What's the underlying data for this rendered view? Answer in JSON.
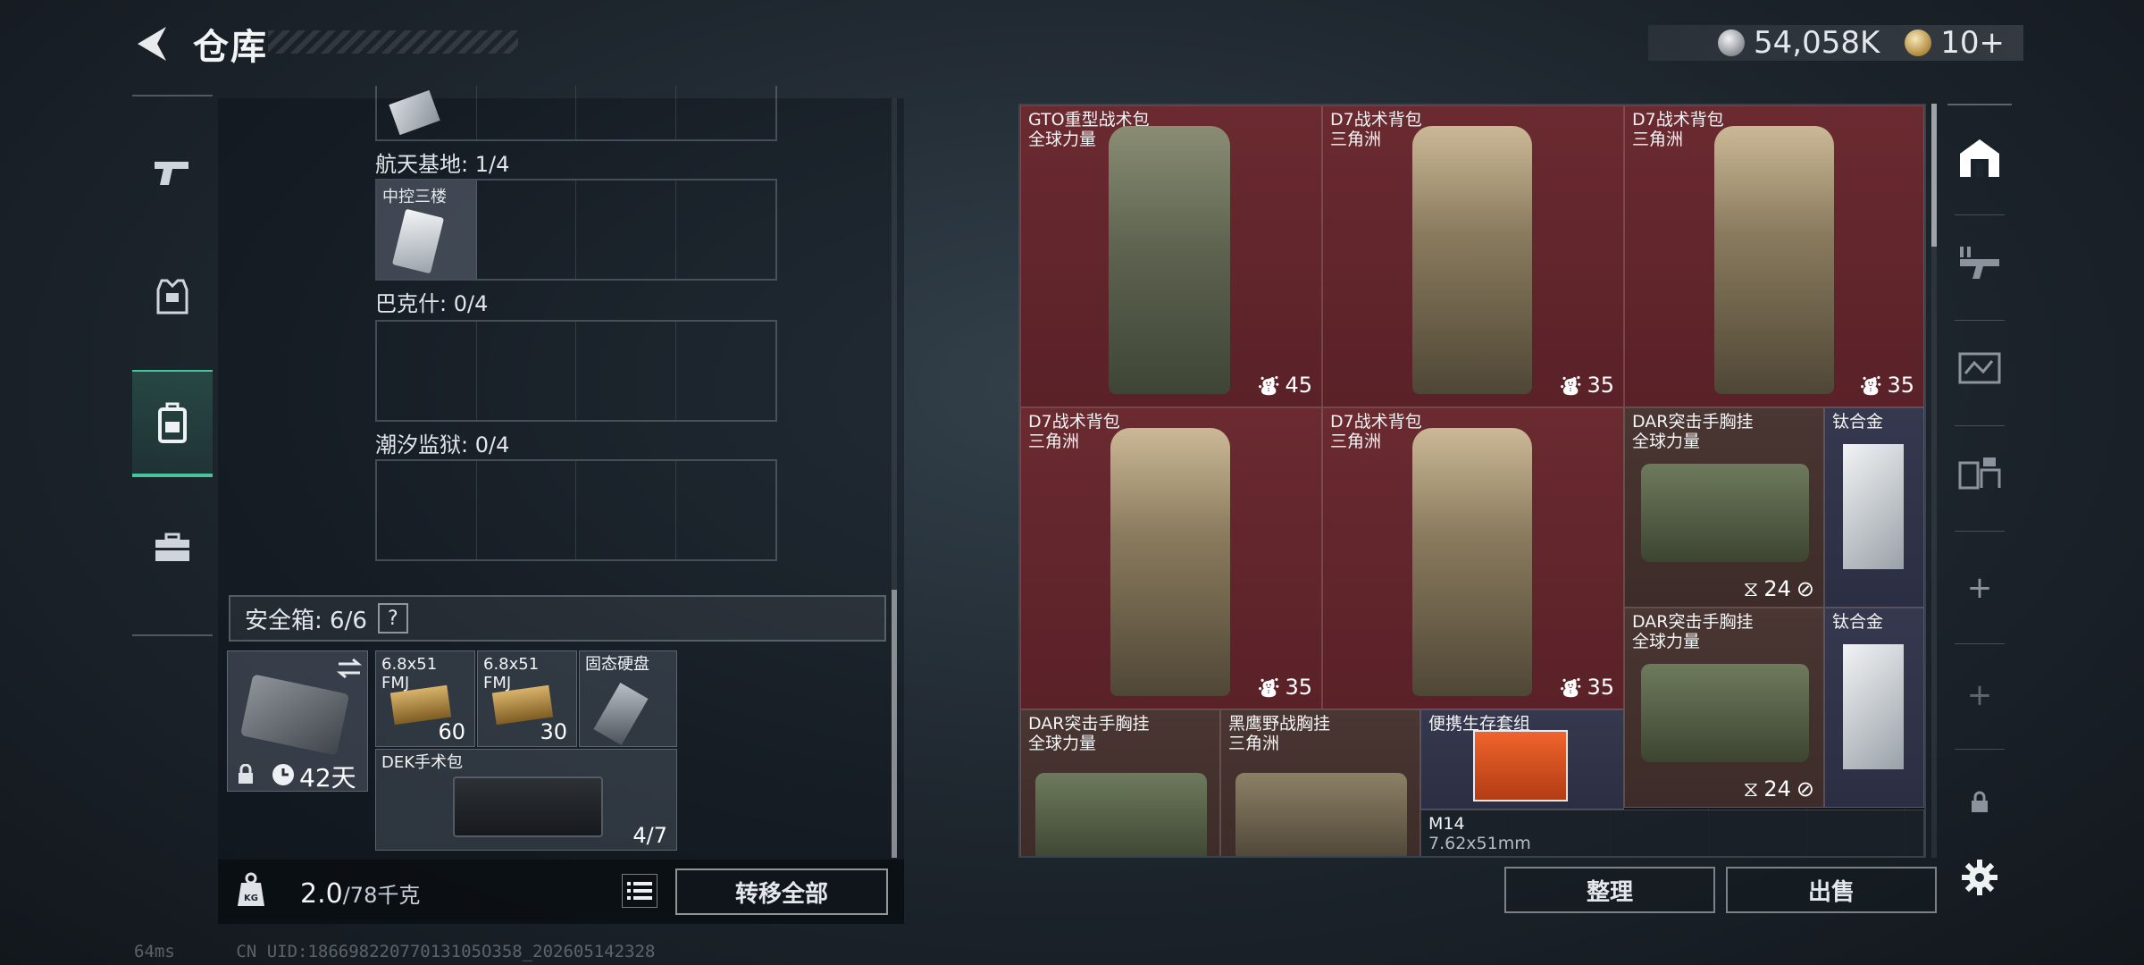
{
  "header": {
    "title": "仓库",
    "currency": {
      "silver": "54,058K",
      "gold": "10+"
    }
  },
  "left_nav": {
    "items": [
      {
        "icon": "pistol-icon"
      },
      {
        "icon": "armor-vest-icon"
      },
      {
        "icon": "backpack-icon",
        "active": true
      },
      {
        "icon": "briefcase-icon"
      }
    ]
  },
  "storage": {
    "sections": [
      {
        "label": "航天基地: 1/4",
        "items": [
          {
            "name": "中控三楼"
          }
        ]
      },
      {
        "label": "巴克什: 0/4",
        "items": []
      },
      {
        "label": "潮汐监狱: 0/4",
        "items": []
      }
    ]
  },
  "safebox": {
    "label": "安全箱: 6/6",
    "help": "?",
    "duration": "42天",
    "items": [
      {
        "name": "6.8x51\nFMJ",
        "count": "60"
      },
      {
        "name": "6.8x51\nFMJ",
        "count": "30"
      },
      {
        "name": "固态硬盘",
        "count": ""
      },
      {
        "name": "DEK手术包",
        "count": "4/7"
      }
    ]
  },
  "weight": {
    "current": "2.0",
    "max": "/78千克"
  },
  "transfer_all": "转移全部",
  "inventory": {
    "items": [
      {
        "name": "GTO重型战术包",
        "sub": "全球力量",
        "cap": "45",
        "color": "red"
      },
      {
        "name": "D7战术背包",
        "sub": "三角洲",
        "cap": "35",
        "color": "red"
      },
      {
        "name": "D7战术背包",
        "sub": "三角洲",
        "cap": "35",
        "color": "red"
      },
      {
        "name": "D7战术背包",
        "sub": "三角洲",
        "cap": "35",
        "color": "red"
      },
      {
        "name": "D7战术背包",
        "sub": "三角洲",
        "cap": "35",
        "color": "red"
      },
      {
        "name": "DAR突击手胸挂",
        "sub": "全球力量",
        "cap": "24",
        "color": "brown"
      },
      {
        "name": "钛合金",
        "sub": "",
        "cap": "",
        "color": "blue"
      },
      {
        "name": "DAR突击手胸挂",
        "sub": "全球力量",
        "cap": "24",
        "color": "brown"
      },
      {
        "name": "钛合金",
        "sub": "",
        "cap": "",
        "color": "blue"
      },
      {
        "name": "DAR突击手胸挂",
        "sub": "全球力量",
        "cap": "",
        "color": "brown"
      },
      {
        "name": "黑鹰野战胸挂",
        "sub": "三角洲",
        "cap": "",
        "color": "brown"
      },
      {
        "name": "便携生存套组",
        "sub": "",
        "cap": "",
        "color": "blue"
      },
      {
        "name": "M14",
        "sub": "7.62x51mm",
        "cap": "",
        "color": "dark"
      }
    ]
  },
  "right_nav": {
    "items": [
      {
        "icon": "storage-home-icon",
        "active": true
      },
      {
        "icon": "weapon-rack-icon"
      },
      {
        "icon": "armory-icon"
      },
      {
        "icon": "workbench-icon"
      },
      {
        "icon": "add-icon"
      },
      {
        "icon": "add-icon"
      },
      {
        "icon": "lock-icon"
      },
      {
        "icon": "settings-icon"
      }
    ]
  },
  "actions": {
    "organize": "整理",
    "sell": "出售"
  },
  "footer": {
    "ping": "64ms",
    "uid": "CN UID:18669822077013105O358_202605142328"
  },
  "colors": {
    "accent": "#47c49a",
    "item_red": "#6a2a30",
    "item_brown": "#4a3632",
    "item_blue": "#36384f"
  }
}
